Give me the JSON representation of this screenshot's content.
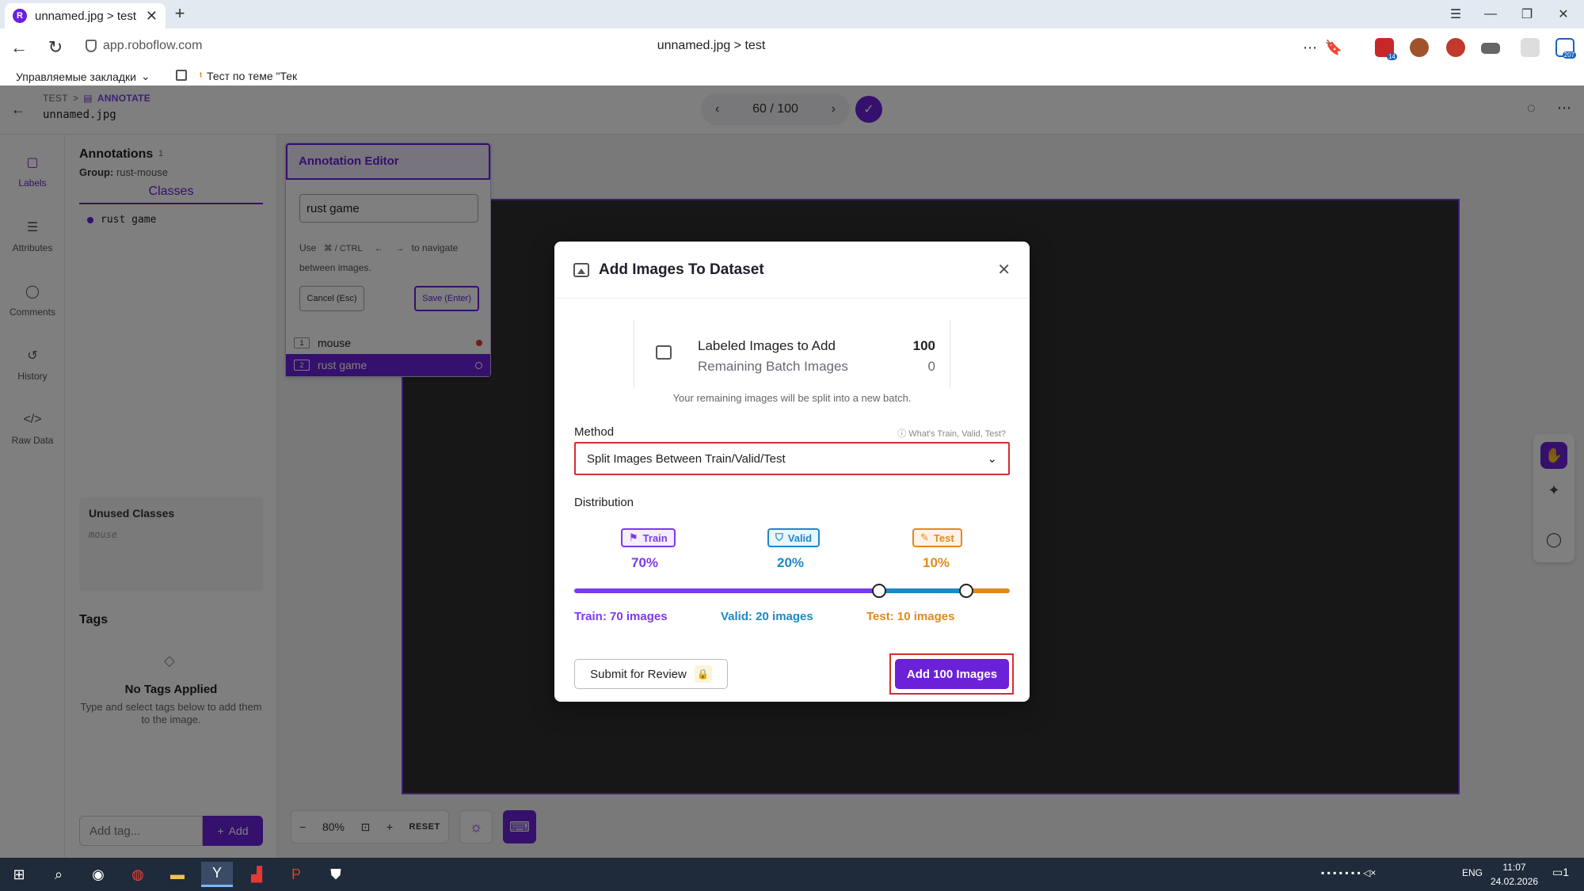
{
  "browser": {
    "tab_title": "unnamed.jpg > test",
    "tab_close": "✕",
    "new_tab": "+",
    "url": "app.roboflow.com",
    "page_title": "unnamed.jpg > test",
    "bookmarks": [
      {
        "label": "Управляемые закладки"
      },
      {
        "label": "Тест по теме \"Тек"
      }
    ],
    "extension_badges": {
      "ext1": "14",
      "ext9": "207"
    }
  },
  "app": {
    "breadcrumb": {
      "project": "TEST",
      "sep": ">",
      "section": "ANNOTATE"
    },
    "filename": "unnamed.jpg",
    "pager": {
      "text": "60 / 100"
    },
    "rail": [
      {
        "label": "Labels",
        "icon": "label-icon"
      },
      {
        "label": "Attributes",
        "icon": "list-icon"
      },
      {
        "label": "Comments",
        "icon": "comment-icon"
      },
      {
        "label": "History",
        "icon": "history-icon"
      },
      {
        "label": "Raw Data",
        "icon": "code-icon"
      }
    ],
    "annotations": {
      "title": "Annotations",
      "count": "1",
      "group_label": "Group:",
      "group_value": "rust-mouse",
      "tab": "Classes",
      "classes": [
        "rust game"
      ],
      "unused_title": "Unused Classes",
      "unused": [
        "mouse"
      ]
    },
    "tags": {
      "title": "Tags",
      "empty_title": "No Tags Applied",
      "empty_desc": "Type and select tags below to add them to the image.",
      "input_placeholder": "Add tag...",
      "add_label": "Add"
    },
    "editor": {
      "title": "Annotation Editor",
      "input_value": "rust game",
      "hint_use": "Use",
      "hint_keys": "⌘ / CTRL",
      "hint_left": "←",
      "hint_right": "→",
      "hint_rest": "to navigate between images.",
      "cancel": "Cancel (Esc)",
      "save": "Save (Enter)",
      "items": [
        {
          "num": "1",
          "label": "mouse"
        },
        {
          "num": "2",
          "label": "rust game"
        }
      ]
    },
    "zoom": {
      "minus": "−",
      "value": "80%",
      "plus": "+",
      "reset": "RESET"
    }
  },
  "modal": {
    "title": "Add Images To Dataset",
    "close": "✕",
    "labeled_label": "Labeled Images to Add",
    "labeled_value": "100",
    "remaining_label": "Remaining Batch Images",
    "remaining_value": "0",
    "note": "Your remaining images will be split into a new batch.",
    "method_label": "Method",
    "method_help": "What's Train, Valid, Test?",
    "method_value": "Split Images Between Train/Valid/Test",
    "distribution_label": "Distribution",
    "splits": [
      {
        "name": "Train",
        "pct": "70%",
        "count_text": "Train: 70 images",
        "fraction": 0.7,
        "color": "#7c3aed"
      },
      {
        "name": "Valid",
        "pct": "20%",
        "count_text": "Valid: 20 images",
        "fraction": 0.2,
        "color": "#1e88c7"
      },
      {
        "name": "Test",
        "pct": "10%",
        "count_text": "Test: 10 images",
        "fraction": 0.1,
        "color": "#e08a1e"
      }
    ],
    "submit_review": "Submit for Review",
    "add_button": "Add 100 Images"
  },
  "taskbar": {
    "lang": "ENG",
    "time": "11:07",
    "date": "24.02.2026",
    "notif": "1"
  },
  "colors": {
    "accent": "#6b21d8",
    "train": "#7c3aed",
    "valid": "#1e88c7",
    "test": "#e08a1e",
    "highlight": "#d32f2f"
  }
}
